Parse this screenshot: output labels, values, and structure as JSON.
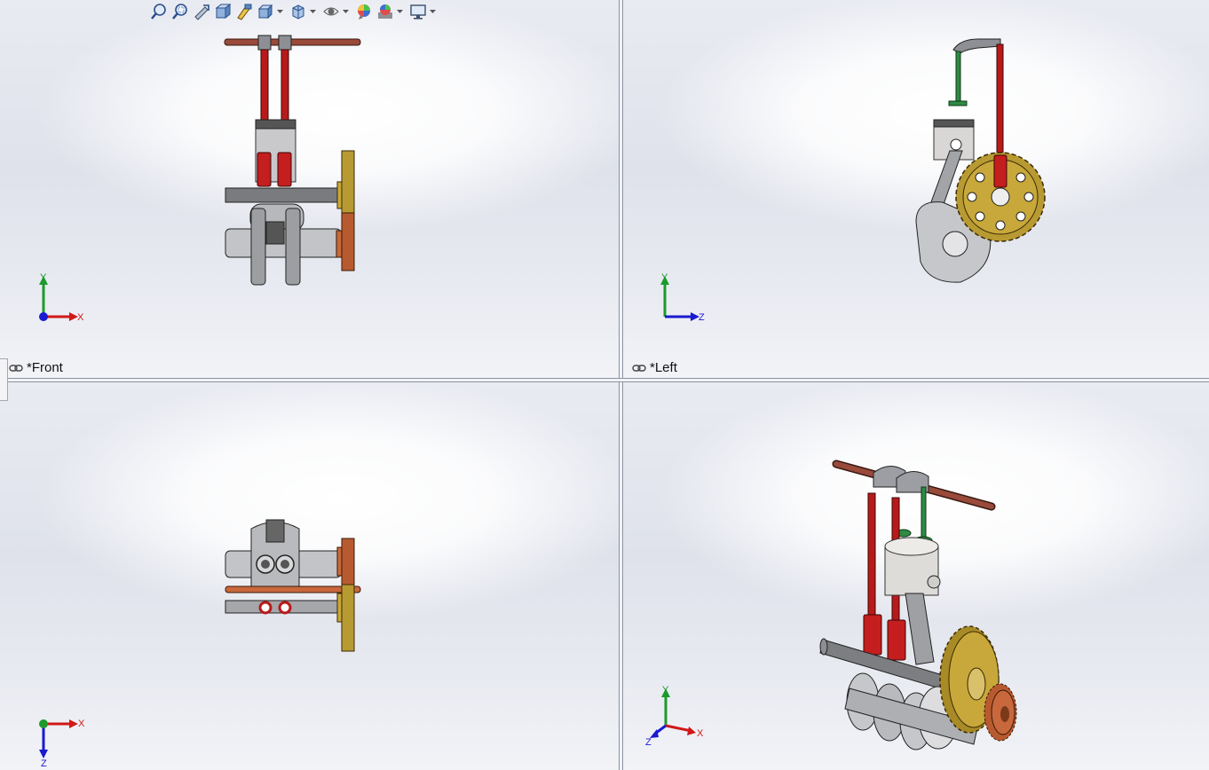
{
  "toolbar": {
    "items": [
      {
        "icon": "zoom-to-fit-icon",
        "dropdown": false
      },
      {
        "icon": "zoom-to-area-icon",
        "dropdown": false
      },
      {
        "icon": "previous-view-icon",
        "dropdown": false
      },
      {
        "icon": "section-view-icon",
        "dropdown": false
      },
      {
        "icon": "dynamic-annotation-icon",
        "dropdown": false
      },
      {
        "icon": "view-orientation-icon",
        "dropdown": true
      },
      {
        "icon": "display-style-icon",
        "dropdown": true
      },
      {
        "icon": "hide-show-items-icon",
        "dropdown": true
      },
      {
        "icon": "edit-appearance-icon",
        "dropdown": false
      },
      {
        "icon": "apply-scene-icon",
        "dropdown": true
      },
      {
        "icon": "view-settings-icon",
        "dropdown": true
      }
    ]
  },
  "viewports": {
    "front": {
      "label": "*Front",
      "triad_axes": [
        "Y",
        "X"
      ]
    },
    "left": {
      "label": "*Left",
      "triad_axes": [
        "Y",
        "Z"
      ]
    },
    "top": {
      "label": "",
      "triad_axes": [
        "X",
        "Z"
      ]
    },
    "iso": {
      "label": "",
      "triad_axes": [
        "Y",
        "X",
        "Z"
      ]
    }
  },
  "colors": {
    "axis_x": "#d01818",
    "axis_y": "#1c9a2a",
    "axis_z": "#1a1ad0",
    "pushrod": "#b81a1a",
    "rocker_shaft": "#9a4a3a",
    "gear_large": "#b89a32",
    "gear_small": "#c8683c",
    "steel": "#a9aaad",
    "valve": "#2f8a44"
  }
}
